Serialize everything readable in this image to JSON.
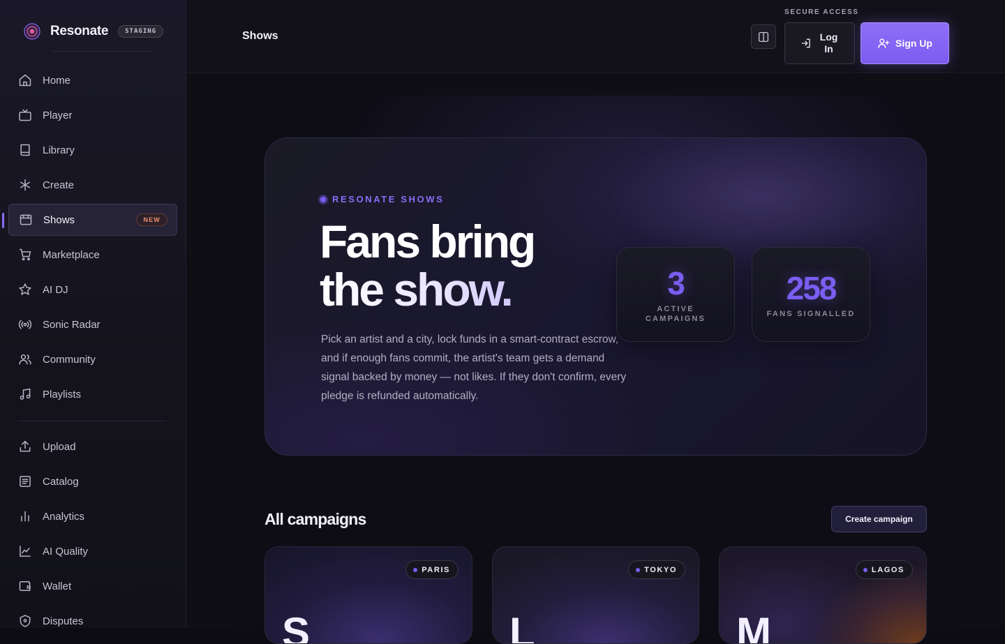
{
  "app": {
    "name": "Resonate",
    "env_badge": "STAGING"
  },
  "sidebar": {
    "items": [
      {
        "label": "Home",
        "icon": "home-icon"
      },
      {
        "label": "Player",
        "icon": "tv-icon"
      },
      {
        "label": "Library",
        "icon": "book-icon"
      },
      {
        "label": "Create",
        "icon": "asterisk-icon"
      },
      {
        "label": "Shows",
        "icon": "ticket-icon",
        "badge": "NEW",
        "active": true
      },
      {
        "label": "Marketplace",
        "icon": "cart-icon"
      },
      {
        "label": "AI DJ",
        "icon": "star-icon"
      },
      {
        "label": "Sonic Radar",
        "icon": "radio-icon"
      },
      {
        "label": "Community",
        "icon": "users-icon"
      },
      {
        "label": "Playlists",
        "icon": "music-icon"
      }
    ],
    "secondary": [
      {
        "label": "Upload",
        "icon": "upload-icon"
      },
      {
        "label": "Catalog",
        "icon": "catalog-icon"
      },
      {
        "label": "Analytics",
        "icon": "bar-chart-icon"
      },
      {
        "label": "AI Quality",
        "icon": "line-chart-icon"
      },
      {
        "label": "Wallet",
        "icon": "wallet-icon"
      },
      {
        "label": "Disputes",
        "icon": "shield-icon"
      }
    ]
  },
  "header": {
    "title": "Shows",
    "secure_label": "SECURE ACCESS",
    "login_label": "Log In",
    "signup_label": "Sign Up"
  },
  "hero": {
    "eyebrow": "RESONATE SHOWS",
    "headline_line1": "Fans bring",
    "headline_line2": "the show.",
    "description": "Pick an artist and a city, lock funds in a smart-contract escrow, and if enough fans commit, the artist's team gets a demand signal backed by money — not likes. If they don't confirm, every pledge is refunded automatically.",
    "stats": [
      {
        "value": "3",
        "label": "ACTIVE CAMPAIGNS"
      },
      {
        "value": "258",
        "label": "FANS SIGNALLED"
      }
    ]
  },
  "campaigns": {
    "title": "All campaigns",
    "create_label": "Create campaign",
    "cards": [
      {
        "city": "PARIS",
        "initial": "S"
      },
      {
        "city": "TOKYO",
        "initial": "L"
      },
      {
        "city": "LAGOS",
        "initial": "M"
      }
    ]
  },
  "colors": {
    "accent": "#8b6cf6",
    "badge_new": "#f0906e",
    "background": "#0d0c14"
  }
}
